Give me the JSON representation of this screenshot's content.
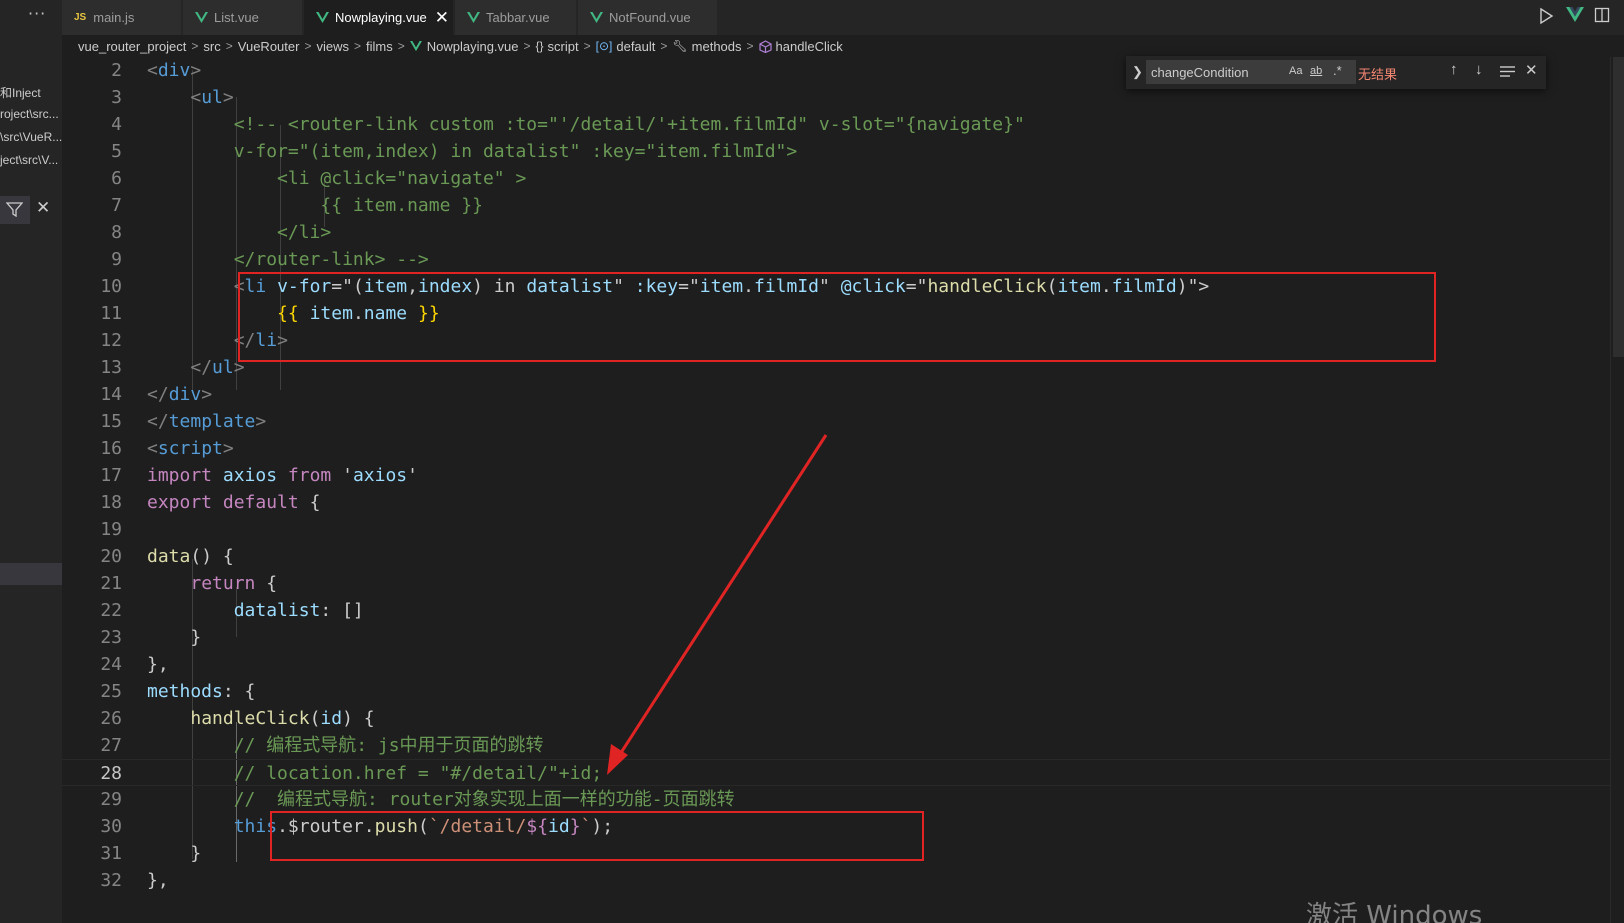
{
  "sidebar": {
    "more_label": "···",
    "refs": [
      "和Inject",
      "roject\\src...",
      "\\src\\VueR...",
      "ject\\src\\V..."
    ]
  },
  "tabs": [
    {
      "label": "main.js",
      "icon": "js-icon",
      "active": false
    },
    {
      "label": "List.vue",
      "icon": "vue-icon",
      "active": false
    },
    {
      "label": "Nowplaying.vue",
      "icon": "vue-icon",
      "active": true
    },
    {
      "label": "Tabbar.vue",
      "icon": "vue-icon",
      "active": false
    },
    {
      "label": "NotFound.vue",
      "icon": "vue-icon",
      "active": false
    }
  ],
  "breadcrumb": [
    "vue_router_project",
    "src",
    "VueRouter",
    "views",
    "films",
    "Nowplaying.vue",
    "script",
    "default",
    "methods",
    "handleClick"
  ],
  "find": {
    "value": "changeCondition",
    "match_case": "Aa",
    "whole_word": "ab",
    "regex": ".*",
    "status": "无结果"
  },
  "lines": [
    {
      "n": "2",
      "code": "    <div>"
    },
    {
      "n": "3",
      "code": "        <ul>"
    },
    {
      "n": "4",
      "code": "            <!-- <router-link custom :to=\"'/detail/'+item.filmId\" v-slot=\"{navigate}\""
    },
    {
      "n": "5",
      "code": "            v-for=\"(item,index) in datalist\" :key=\"item.filmId\">"
    },
    {
      "n": "6",
      "code": "                <li @click=\"navigate\" >"
    },
    {
      "n": "7",
      "code": "                    {{ item.name }}"
    },
    {
      "n": "8",
      "code": "                </li>"
    },
    {
      "n": "9",
      "code": "            </router-link> -->"
    },
    {
      "n": "10",
      "code": "            <li v-for=\"(item,index) in datalist\" :key=\"item.filmId\" @click=\"handleClick(item.filmId)\">"
    },
    {
      "n": "11",
      "code": "                {{ item.name }}"
    },
    {
      "n": "12",
      "code": "            </li>"
    },
    {
      "n": "13",
      "code": "        </ul>"
    },
    {
      "n": "14",
      "code": "    </div>"
    },
    {
      "n": "15",
      "code": "</template>"
    },
    {
      "n": "16",
      "code": "<script>"
    },
    {
      "n": "17",
      "code": "import axios from 'axios'"
    },
    {
      "n": "18",
      "code": "export default {"
    },
    {
      "n": "19",
      "code": ""
    },
    {
      "n": "20",
      "code": "    data() {"
    },
    {
      "n": "21",
      "code": "        return {"
    },
    {
      "n": "22",
      "code": "            datalist: []"
    },
    {
      "n": "23",
      "code": "        }"
    },
    {
      "n": "24",
      "code": "    },"
    },
    {
      "n": "25",
      "code": "    methods: {"
    },
    {
      "n": "26",
      "code": "        handleClick(id) {"
    },
    {
      "n": "27",
      "code": "            // 编程式导航: js中用于页面的跳转"
    },
    {
      "n": "28",
      "code": "            // location.href = \"#/detail/\"+id;"
    },
    {
      "n": "29",
      "code": "            //  编程式导航: router对象实现上面一样的功能-页面跳转"
    },
    {
      "n": "30",
      "code": "            this.$router.push(`/detail/${id}`);"
    },
    {
      "n": "31",
      "code": "        }"
    },
    {
      "n": "32",
      "code": "    },"
    }
  ],
  "watermark": "激活 Windows",
  "colors": {
    "annotation_red": "#e02424",
    "vue_green": "#41b883",
    "editor_bg": "#1e1e1e"
  }
}
